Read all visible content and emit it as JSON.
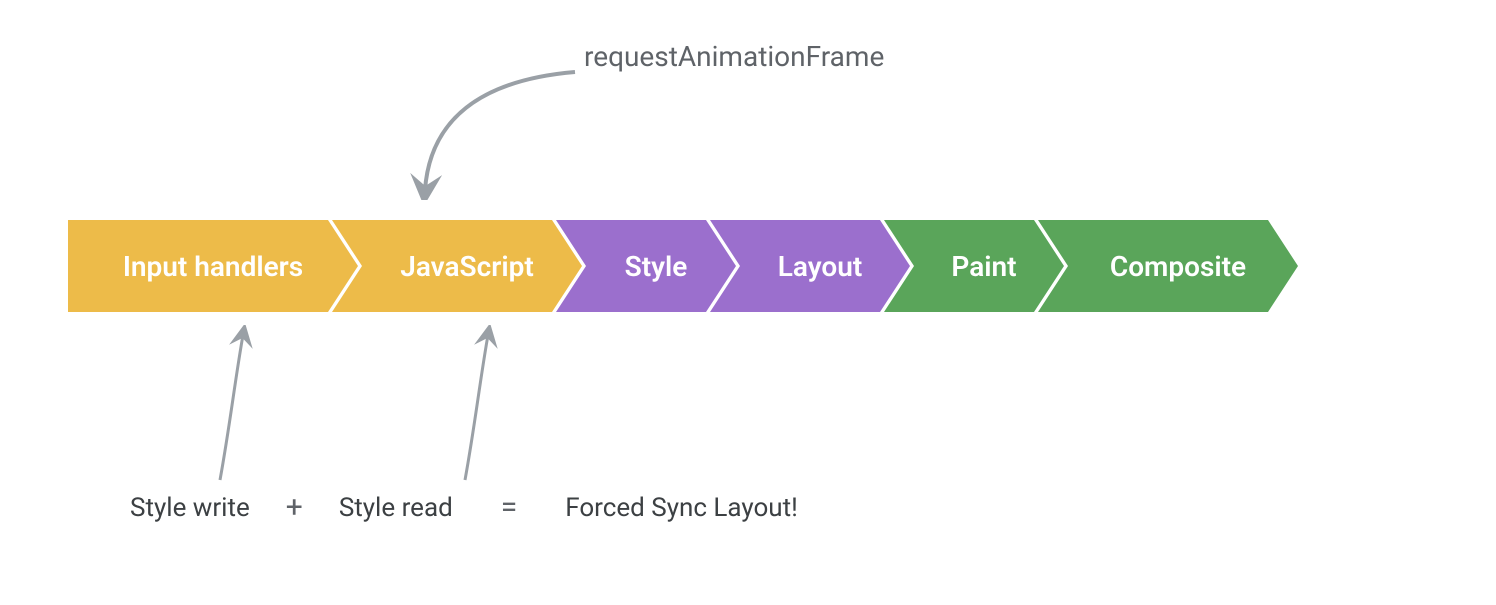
{
  "top_annotation": "requestAnimationFrame",
  "pipeline": [
    {
      "label": "Input handlers",
      "color": "yellow"
    },
    {
      "label": "JavaScript",
      "color": "yellow"
    },
    {
      "label": "Style",
      "color": "purple"
    },
    {
      "label": "Layout",
      "color": "purple"
    },
    {
      "label": "Paint",
      "color": "green"
    },
    {
      "label": "Composite",
      "color": "green"
    }
  ],
  "bottom": {
    "left": "Style write",
    "plus": "+",
    "middle": "Style read",
    "eq": "=",
    "result": "Forced Sync Layout!"
  },
  "pipeline_widths": [
    290,
    250,
    180,
    200,
    180,
    260
  ]
}
